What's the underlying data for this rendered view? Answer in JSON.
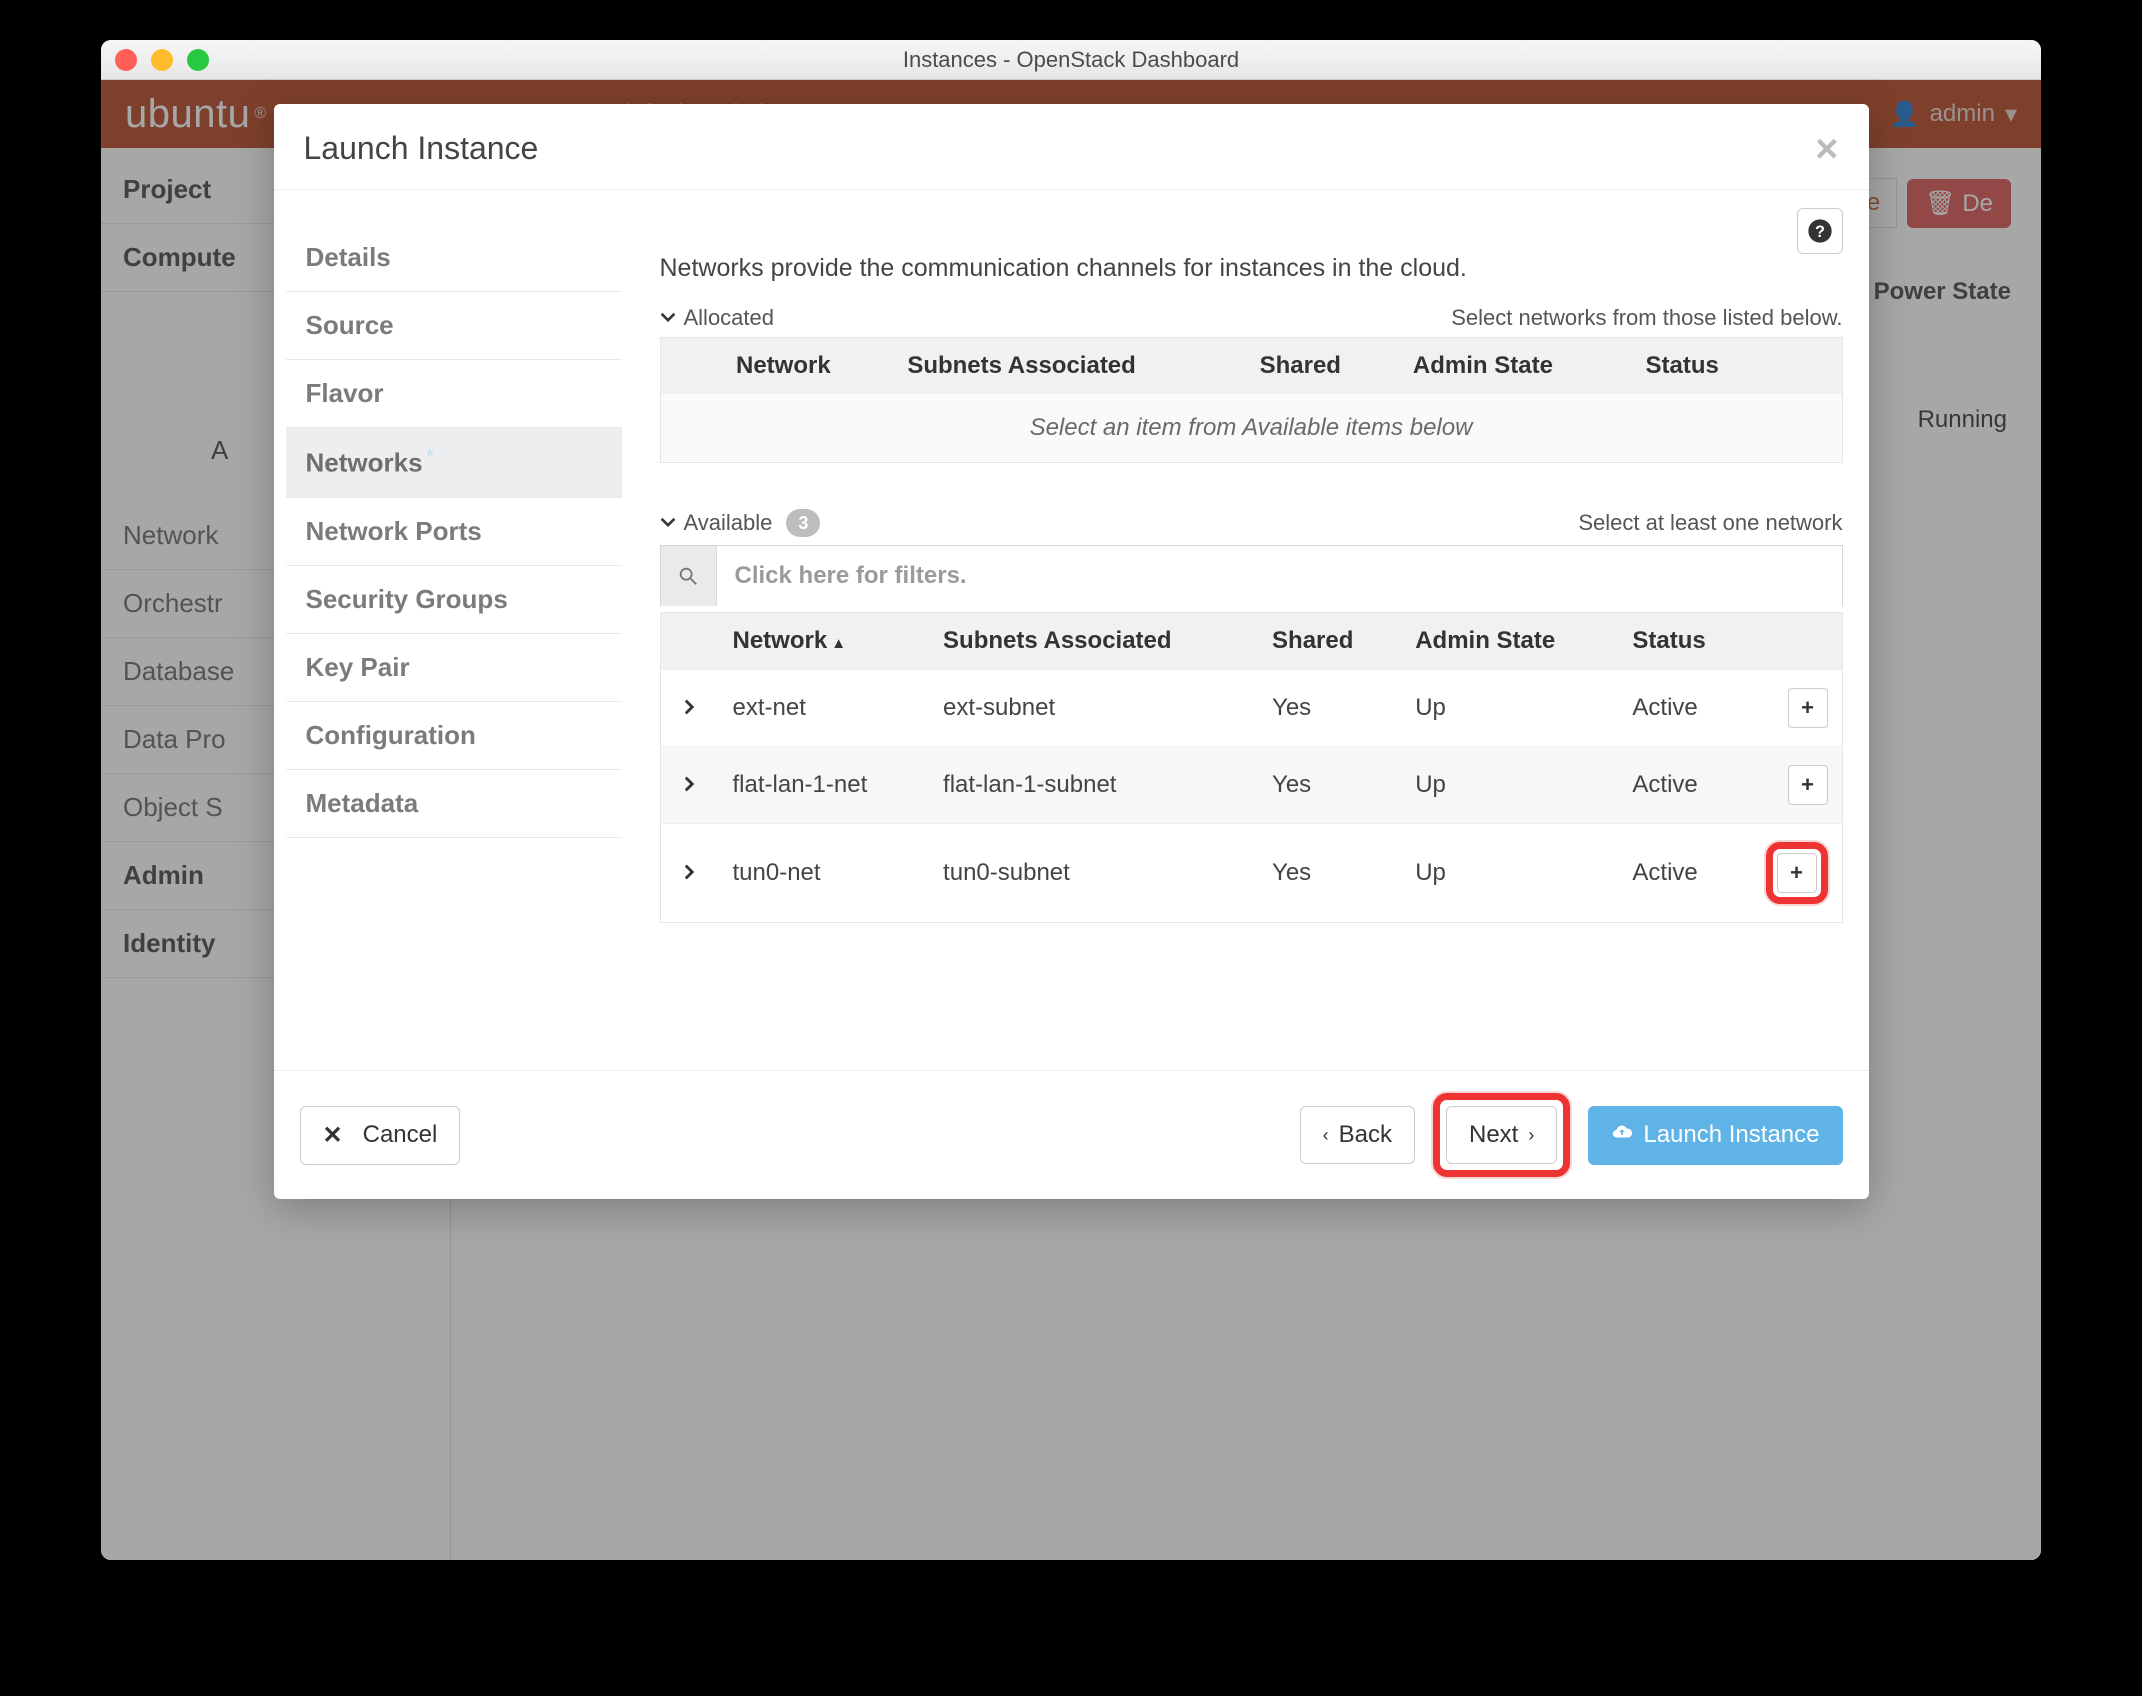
{
  "window": {
    "title": "Instances - OpenStack Dashboard"
  },
  "topbar": {
    "brand": "ubuntu",
    "domain_label": "default • admin",
    "user_label": "admin"
  },
  "sidebar": {
    "items": [
      {
        "label": "Project",
        "kind": "header"
      },
      {
        "label": "Compute",
        "kind": "header"
      },
      {
        "label": "Network",
        "kind": "sub"
      },
      {
        "label": "Orchestr",
        "kind": "sub"
      },
      {
        "label": "Database",
        "kind": "sub"
      },
      {
        "label": "Data Pro",
        "kind": "sub"
      },
      {
        "label": "Object S",
        "kind": "sub"
      },
      {
        "label": "Admin",
        "kind": "header"
      },
      {
        "label": "Identity",
        "kind": "header-caret"
      }
    ]
  },
  "background": {
    "launch_partial": "ce",
    "delete_partial": "De",
    "power_state_header": "Power State",
    "a_char": "A",
    "running": "Running"
  },
  "modal": {
    "title": "Launch Instance",
    "steps": [
      {
        "label": "Details"
      },
      {
        "label": "Source"
      },
      {
        "label": "Flavor"
      },
      {
        "label": "Networks",
        "active": true,
        "required": true
      },
      {
        "label": "Network Ports"
      },
      {
        "label": "Security Groups"
      },
      {
        "label": "Key Pair"
      },
      {
        "label": "Configuration"
      },
      {
        "label": "Metadata"
      }
    ],
    "intro": "Networks provide the communication channels for instances in the cloud.",
    "allocated": {
      "label": "Allocated",
      "hint": "Select networks from those listed below.",
      "columns": [
        "Network",
        "Subnets Associated",
        "Shared",
        "Admin State",
        "Status"
      ],
      "empty_text": "Select an item from Available items below"
    },
    "available": {
      "label": "Available",
      "count": "3",
      "hint": "Select at least one network",
      "filter_placeholder": "Click here for filters.",
      "columns": [
        "Network",
        "Subnets Associated",
        "Shared",
        "Admin State",
        "Status"
      ],
      "rows": [
        {
          "network": "ext-net",
          "subnet": "ext-subnet",
          "shared": "Yes",
          "admin": "Up",
          "status": "Active",
          "highlighted": false
        },
        {
          "network": "flat-lan-1-net",
          "subnet": "flat-lan-1-subnet",
          "shared": "Yes",
          "admin": "Up",
          "status": "Active",
          "highlighted": false
        },
        {
          "network": "tun0-net",
          "subnet": "tun0-subnet",
          "shared": "Yes",
          "admin": "Up",
          "status": "Active",
          "highlighted": true
        }
      ]
    },
    "buttons": {
      "cancel": "Cancel",
      "back": "Back",
      "next": "Next",
      "launch": "Launch Instance"
    }
  }
}
